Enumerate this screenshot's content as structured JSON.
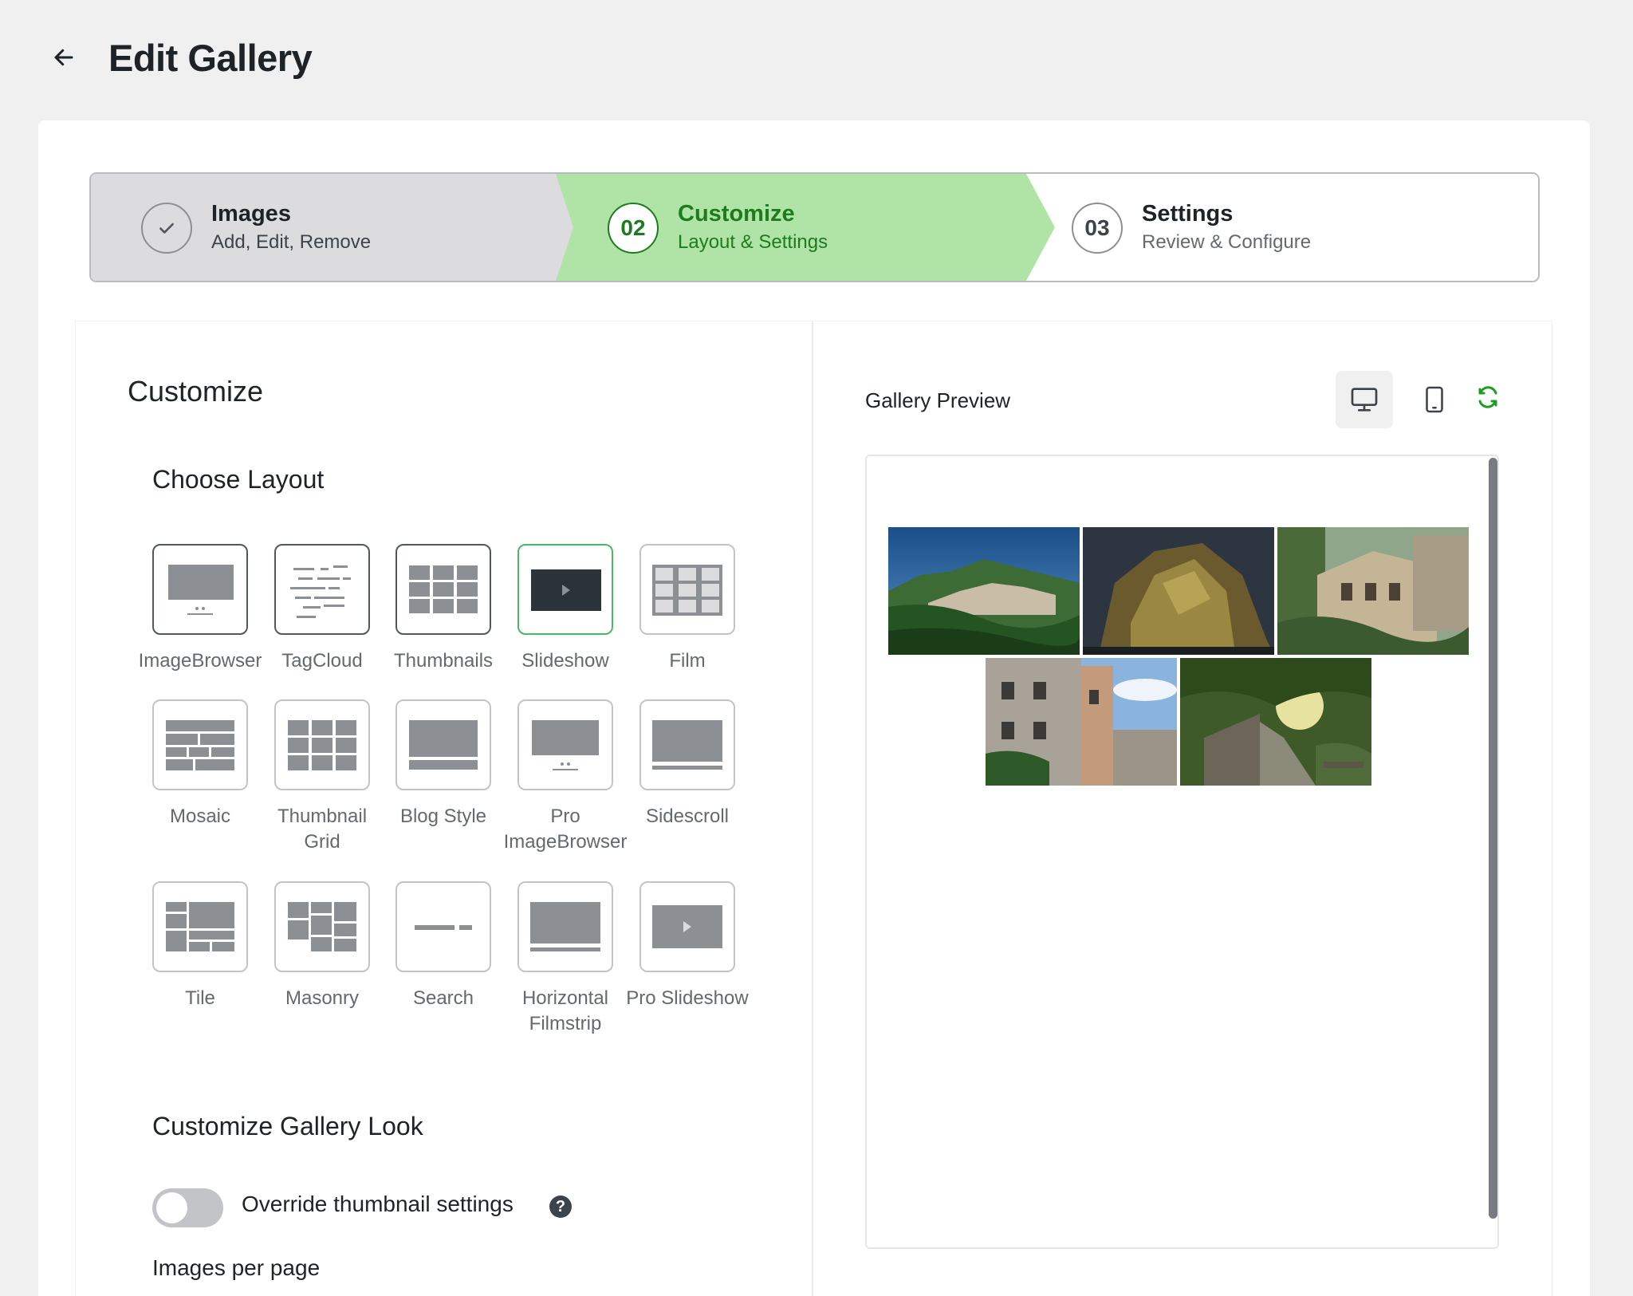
{
  "header": {
    "title": "Edit Gallery",
    "back_icon": "arrow-left-icon"
  },
  "stepper": {
    "steps": [
      {
        "marker": "check-icon",
        "title": "Images",
        "subtitle": "Add, Edit, Remove",
        "state": "completed"
      },
      {
        "marker": "02",
        "title": "Customize",
        "subtitle": "Layout & Settings",
        "state": "active"
      },
      {
        "marker": "03",
        "title": "Settings",
        "subtitle": "Review & Configure",
        "state": "upcoming"
      }
    ]
  },
  "customize": {
    "title": "Customize",
    "choose_layout_title": "Choose Layout",
    "layouts": [
      {
        "label": "ImageBrowser",
        "icon": "imagebrowser-icon"
      },
      {
        "label": "TagCloud",
        "icon": "tagcloud-icon"
      },
      {
        "label": "Thumbnails",
        "icon": "thumbnails-icon"
      },
      {
        "label": "Slideshow",
        "icon": "slideshow-icon",
        "selected": true
      },
      {
        "label": "Film",
        "icon": "film-icon"
      },
      {
        "label": "Mosaic",
        "icon": "mosaic-icon"
      },
      {
        "label": "Thumbnail Grid",
        "icon": "thumbnail-grid-icon"
      },
      {
        "label": "Blog Style",
        "icon": "blog-style-icon"
      },
      {
        "label": "Pro ImageBrowser",
        "icon": "pro-imagebrowser-icon"
      },
      {
        "label": "Sidescroll",
        "icon": "sidescroll-icon"
      },
      {
        "label": "Tile",
        "icon": "tile-icon"
      },
      {
        "label": "Masonry",
        "icon": "masonry-icon"
      },
      {
        "label": "Search",
        "icon": "search-layout-icon"
      },
      {
        "label": "Horizontal Filmstrip",
        "icon": "horizontal-filmstrip-icon"
      },
      {
        "label": "Pro Slideshow",
        "icon": "pro-slideshow-icon"
      }
    ],
    "look_title": "Customize Gallery Look",
    "override_label": "Override thumbnail settings",
    "override_enabled": false,
    "help_icon": "?",
    "images_per_page_label": "Images per page"
  },
  "preview": {
    "title": "Gallery Preview",
    "device_buttons": [
      "desktop-icon",
      "mobile-icon",
      "refresh-icon"
    ],
    "active_device": "desktop",
    "photos": [
      "mountain-village-photo",
      "rock-night-photo",
      "old-mansion-photo",
      "building-facade-photo",
      "forest-path-photo"
    ]
  },
  "colors": {
    "accent_green": "#4ab866",
    "active_step_bg": "#b0e4a6",
    "active_step_text": "#1e7b1e",
    "completed_step_bg": "#dcdcde"
  }
}
